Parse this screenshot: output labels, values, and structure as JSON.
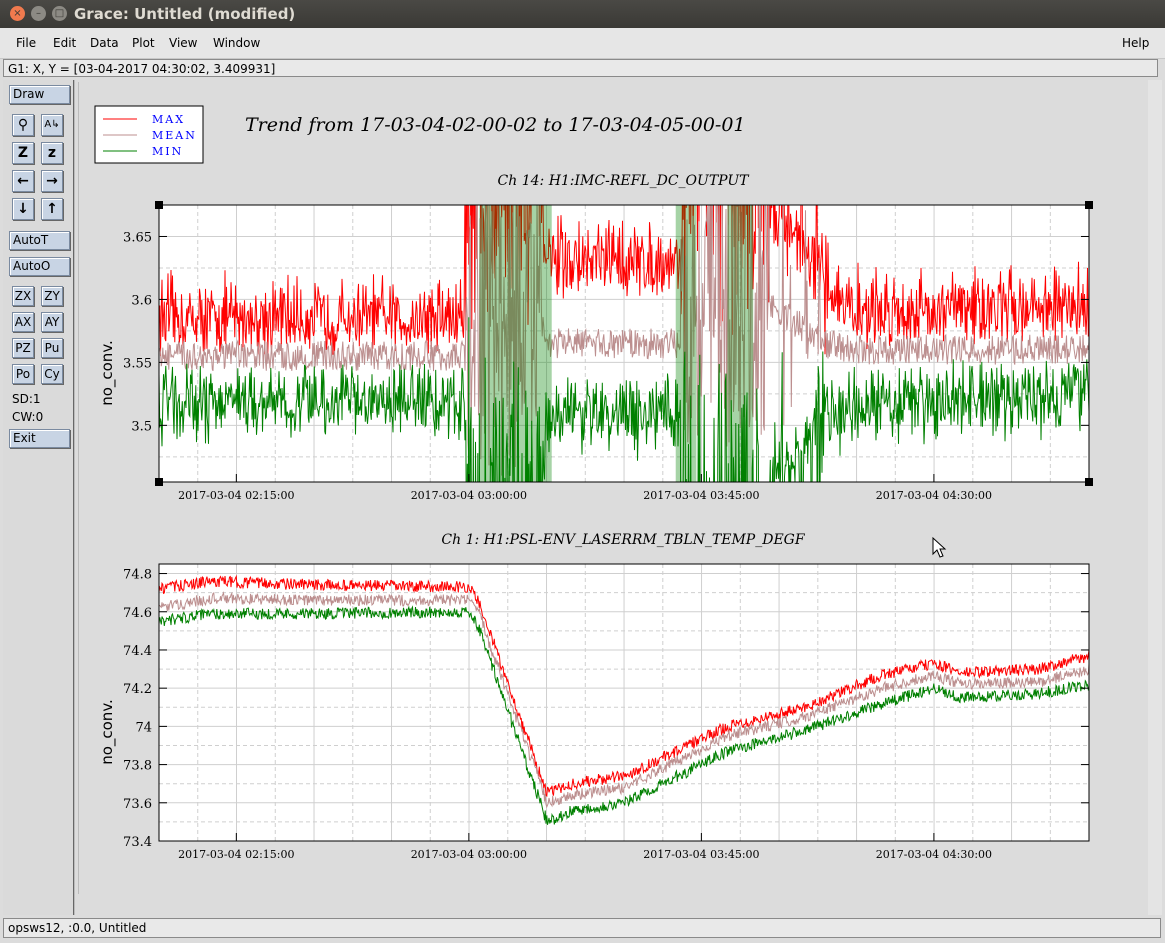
{
  "window": {
    "title": "Grace: Untitled (modified)"
  },
  "menu": {
    "file": "File",
    "edit": "Edit",
    "data": "Data",
    "plot": "Plot",
    "view": "View",
    "window": "Window",
    "help": "Help"
  },
  "locator": "G1: X, Y = [03-04-2017 04:30:02, 3.409931]",
  "toolbar": {
    "draw": "Draw",
    "autot": "AutoT",
    "autoo": "AutoO",
    "zx": "ZX",
    "zy": "ZY",
    "ax": "AX",
    "ay": "AY",
    "pz": "PZ",
    "pu": "Pu",
    "po": "Po",
    "cy": "Cy",
    "sd": "SD:1",
    "cw": "CW:0",
    "exit": "Exit",
    "zoom_in": "Z",
    "zoom_out": "z"
  },
  "status": "opsws12, :0.0, Untitled",
  "colors": {
    "max": "#ff0000",
    "mean": "#bc8f8f",
    "min": "#008000",
    "legend_text": "#0000ff"
  },
  "chart_data": [
    {
      "type": "line",
      "title": "Trend from 17-03-04-02-00-02 to 17-03-04-05-00-01",
      "legend": [
        "MAX",
        "MEAN",
        "MIN"
      ],
      "legend_position": "top-left"
    },
    {
      "type": "line",
      "title": "Ch 14: H1:IMC-REFL_DC_OUTPUT",
      "ylabel": "no_conv.",
      "xlim": [
        "2017-03-04 02:00:02",
        "2017-03-04 05:00:01"
      ],
      "ylim": [
        3.455,
        3.675
      ],
      "xticks": [
        "2017-03-04 02:15:00",
        "2017-03-04 03:00:00",
        "2017-03-04 03:45:00",
        "2017-03-04 04:30:00"
      ],
      "yticks": [
        "3.5",
        "3.55",
        "3.6",
        "3.65"
      ],
      "grid": true,
      "x_minutes": [
        0,
        30,
        59,
        60,
        74,
        75,
        101,
        102,
        115,
        117,
        129,
        135,
        180
      ],
      "series": [
        {
          "name": "MAX",
          "mean_level": [
            3.575,
            3.575,
            3.575,
            3.66,
            3.66,
            3.62,
            3.62,
            3.675,
            3.675,
            3.675,
            3.6,
            3.58,
            3.585
          ]
        },
        {
          "name": "MEAN",
          "mean_level": [
            3.555,
            3.555,
            3.555,
            3.58,
            3.58,
            3.565,
            3.565,
            3.6,
            3.6,
            3.6,
            3.565,
            3.56,
            3.56
          ]
        },
        {
          "name": "MIN",
          "mean_level": [
            3.53,
            3.53,
            3.53,
            3.47,
            3.47,
            3.52,
            3.52,
            3.46,
            3.46,
            3.46,
            3.52,
            3.53,
            3.535
          ]
        }
      ]
    },
    {
      "type": "line",
      "title": "Ch 1: H1:PSL-ENV_LASERRM_TBLN_TEMP_DEGF",
      "ylabel": "no_conv.",
      "xlim": [
        "2017-03-04 02:00:02",
        "2017-03-04 05:00:01"
      ],
      "ylim": [
        73.4,
        74.85
      ],
      "xticks": [
        "2017-03-04 02:15:00",
        "2017-03-04 03:00:00",
        "2017-03-04 03:45:00",
        "2017-03-04 04:30:00"
      ],
      "yticks": [
        "73.4",
        "73.6",
        "73.8",
        "74",
        "74.2",
        "74.4",
        "74.6",
        "74.8"
      ],
      "grid": true,
      "x_minutes": [
        0,
        10,
        30,
        60,
        62,
        75,
        80,
        90,
        110,
        125,
        140,
        150,
        155,
        170,
        180
      ],
      "series": [
        {
          "name": "MAX",
          "values": [
            74.72,
            74.76,
            74.74,
            74.73,
            74.64,
            73.65,
            73.7,
            73.74,
            74.0,
            74.1,
            74.27,
            74.33,
            74.28,
            74.3,
            74.37
          ]
        },
        {
          "name": "MEAN",
          "values": [
            74.62,
            74.67,
            74.66,
            74.66,
            74.58,
            73.6,
            73.64,
            73.68,
            73.95,
            74.05,
            74.2,
            74.27,
            74.22,
            74.23,
            74.3
          ]
        },
        {
          "name": "MIN",
          "values": [
            74.55,
            74.59,
            74.59,
            74.6,
            74.5,
            73.5,
            73.56,
            73.6,
            73.87,
            73.98,
            74.12,
            74.2,
            74.15,
            74.17,
            74.22
          ]
        }
      ]
    }
  ]
}
